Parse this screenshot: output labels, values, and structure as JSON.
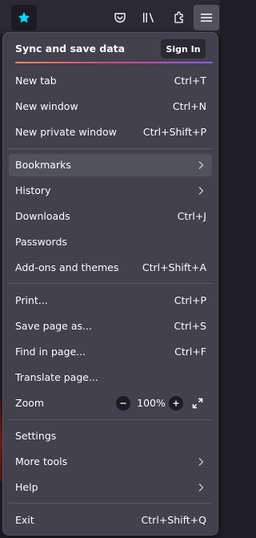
{
  "toolbar": {
    "icons": [
      "star-icon",
      "pocket-icon",
      "library-icon",
      "extensions-icon",
      "hamburger-menu-icon"
    ]
  },
  "menu": {
    "sync_title": "Sync and save data",
    "sign_in_label": "Sign In",
    "items": {
      "new_tab": {
        "label": "New tab",
        "shortcut": "Ctrl+T"
      },
      "new_window": {
        "label": "New window",
        "shortcut": "Ctrl+N"
      },
      "new_private_window": {
        "label": "New private window",
        "shortcut": "Ctrl+Shift+P"
      },
      "bookmarks": {
        "label": "Bookmarks"
      },
      "history": {
        "label": "History"
      },
      "downloads": {
        "label": "Downloads",
        "shortcut": "Ctrl+J"
      },
      "passwords": {
        "label": "Passwords"
      },
      "addons": {
        "label": "Add-ons and themes",
        "shortcut": "Ctrl+Shift+A"
      },
      "print": {
        "label": "Print...",
        "shortcut": "Ctrl+P"
      },
      "save_page": {
        "label": "Save page as...",
        "shortcut": "Ctrl+S"
      },
      "find_in_page": {
        "label": "Find in page...",
        "shortcut": "Ctrl+F"
      },
      "translate_page": {
        "label": "Translate page..."
      },
      "zoom": {
        "label": "Zoom",
        "value": "100%"
      },
      "settings": {
        "label": "Settings"
      },
      "more_tools": {
        "label": "More tools"
      },
      "help": {
        "label": "Help"
      },
      "exit": {
        "label": "Exit",
        "shortcut": "Ctrl+Shift+Q"
      }
    }
  },
  "colors": {
    "accent_star": "#00ddff",
    "panel_bg": "#42414d",
    "hover_bg": "#52525e",
    "gradient": [
      "#ff8a50",
      "#e0427e",
      "#9059ff"
    ]
  }
}
